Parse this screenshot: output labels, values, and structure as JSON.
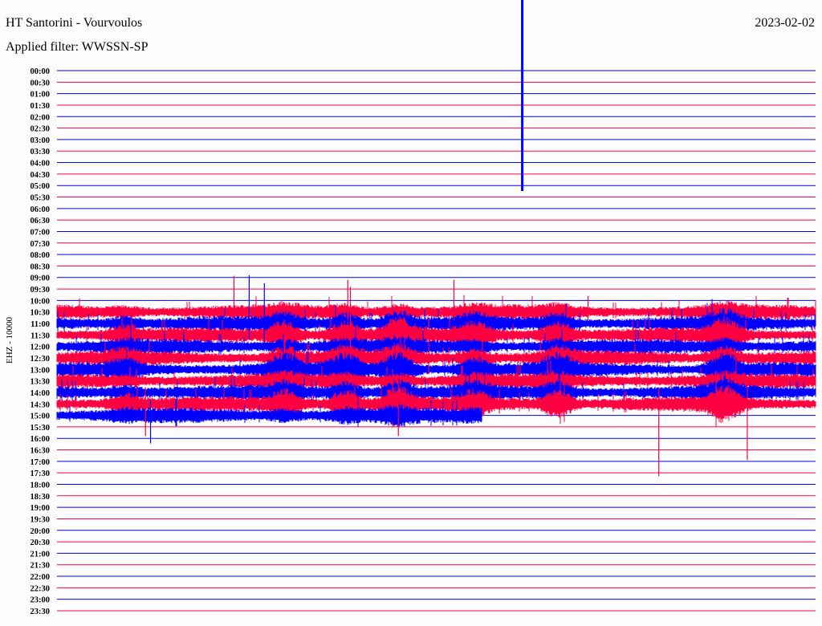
{
  "header": {
    "title": "HT Santorini - Vourvoulos",
    "filter": "Applied filter: WWSSN-SP",
    "date": "2023-02-02"
  },
  "chart_data": {
    "type": "helicorder",
    "title": "HT Santorini - Vourvoulos",
    "ylabel": "EHZ - 10000",
    "minutes_per_row": 30,
    "row_labels": [
      "00:00",
      "00:30",
      "01:00",
      "01:30",
      "02:00",
      "02:30",
      "03:00",
      "03:30",
      "04:00",
      "04:30",
      "05:00",
      "05:30",
      "06:00",
      "06:30",
      "07:00",
      "07:30",
      "08:00",
      "08:30",
      "09:00",
      "09:30",
      "10:00",
      "10:30",
      "11:00",
      "11:30",
      "12:00",
      "12:30",
      "13:00",
      "13:30",
      "14:00",
      "14:30",
      "15:00",
      "15:30",
      "16:00",
      "16:30",
      "17:00",
      "17:30",
      "18:00",
      "18:30",
      "19:00",
      "19:30",
      "20:00",
      "20:30",
      "21:00",
      "21:30",
      "22:00",
      "22:30",
      "23:00",
      "23:30"
    ],
    "colors": [
      "#0000ff",
      "#ff0040"
    ],
    "active_rows": {
      "first": 21,
      "last": 30,
      "last_row_end_minute": 16.8
    },
    "events": [
      {
        "row": 0,
        "minute": 18.4,
        "up": 120,
        "down": 150
      },
      {
        "row": 21,
        "minute": 7.0,
        "up": 45,
        "down": 10
      },
      {
        "row": 21,
        "minute": 11.5,
        "up": 40,
        "down": 10
      },
      {
        "row": 21,
        "minute": 15.7,
        "up": 40,
        "down": 10
      },
      {
        "row": 21,
        "minute": 21.0,
        "up": 20,
        "down": 10
      },
      {
        "row": 22,
        "minute": 7.6,
        "up": 60,
        "down": 20
      },
      {
        "row": 22,
        "minute": 8.2,
        "up": 50,
        "down": 20
      },
      {
        "row": 23,
        "minute": 11.6,
        "up": 60,
        "down": 30
      },
      {
        "row": 25,
        "minute": 14.7,
        "up": 50,
        "down": 20
      },
      {
        "row": 29,
        "minute": 3.5,
        "up": 20,
        "down": 40
      },
      {
        "row": 29,
        "minute": 13.5,
        "up": 25,
        "down": 40
      },
      {
        "row": 29,
        "minute": 27.3,
        "up": 25,
        "down": 70
      },
      {
        "row": 30,
        "minute": 3.7,
        "up": 20,
        "down": 35
      },
      {
        "row": 29,
        "minute": 23.8,
        "up": 20,
        "down": 90
      }
    ]
  }
}
